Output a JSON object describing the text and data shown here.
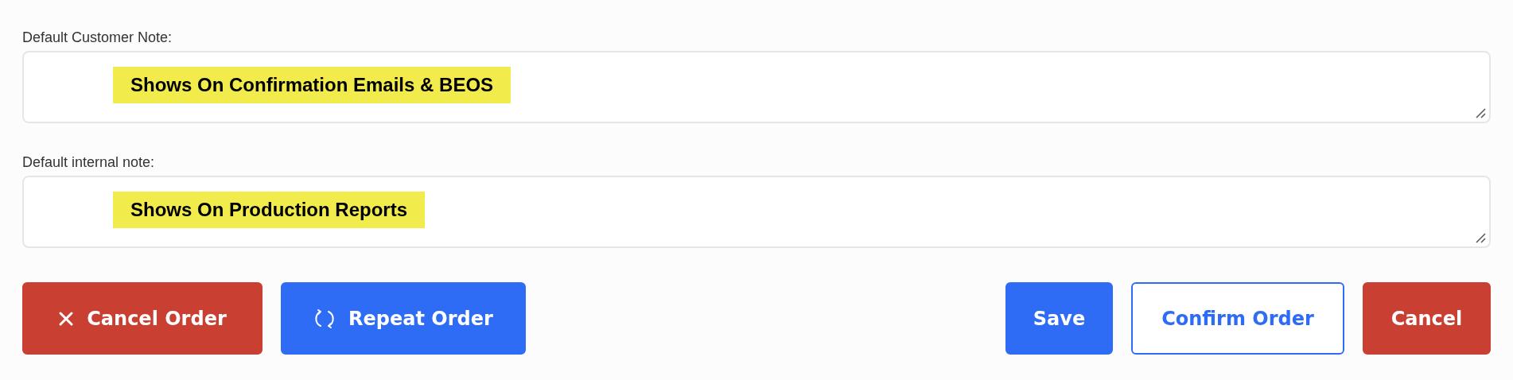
{
  "notes": [
    {
      "label": "Default Customer Note:",
      "value": "Shows On Confirmation Emails & BEOS"
    },
    {
      "label": "Default internal note:",
      "value": "Shows On Production Reports"
    }
  ],
  "actions_left": [
    {
      "label": "Cancel Order",
      "kind": "danger"
    },
    {
      "label": "Repeat Order",
      "kind": "primary"
    }
  ],
  "actions_right": [
    {
      "label": "Save",
      "kind": "primary"
    },
    {
      "label": "Confirm Order",
      "kind": "outline"
    },
    {
      "label": "Cancel",
      "kind": "danger"
    }
  ]
}
